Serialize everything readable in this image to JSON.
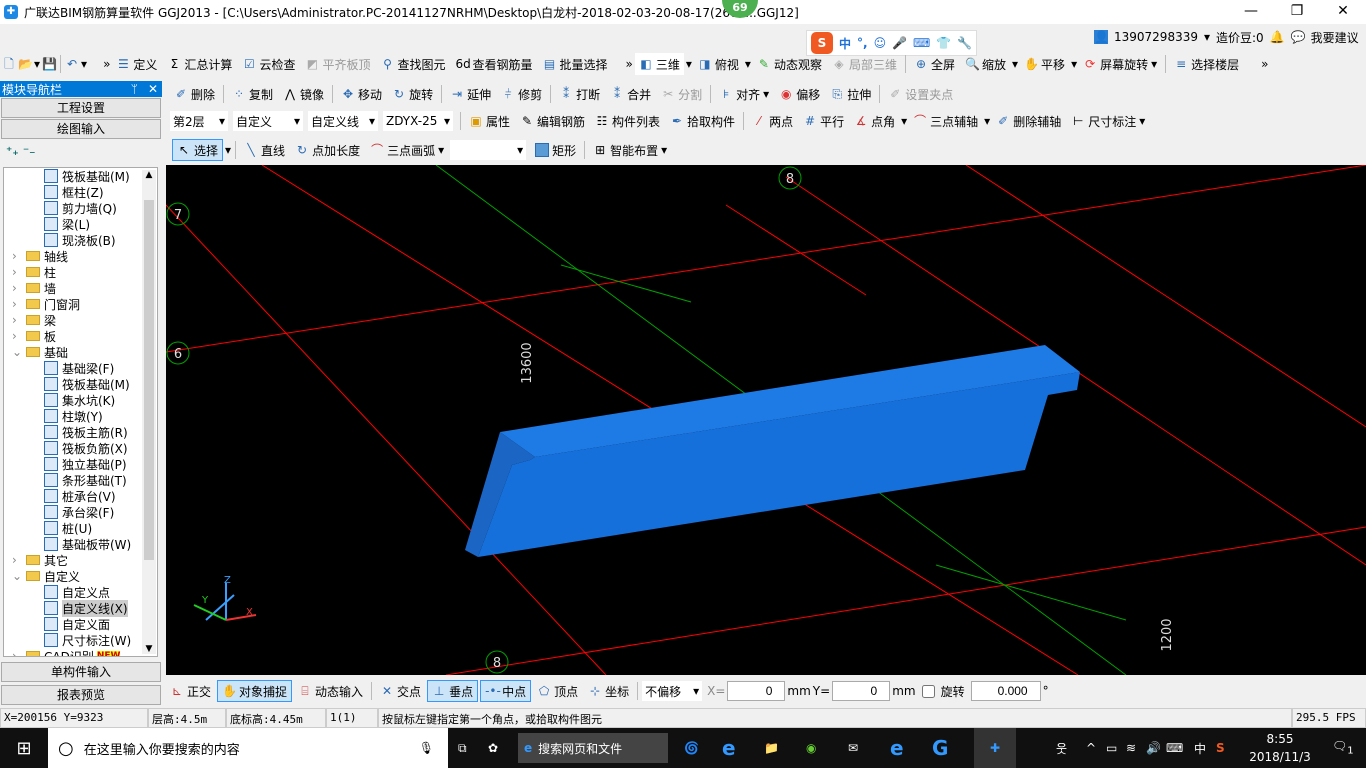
{
  "window": {
    "title": "广联达BIM钢筋算量软件 GGJ2013 - [C:\\Users\\Administrator.PC-20141127NRHM\\Desktop\\白龙村-2018-02-03-20-08-17(2605...GGJ12]",
    "badge": "69",
    "min": "—",
    "max": "❐",
    "close": "✕"
  },
  "user": {
    "phone": "13907298339",
    "beans": "造价豆:0",
    "suggest": "我要建议"
  },
  "ime": {
    "items": [
      "中",
      "°,",
      "☺",
      "🎤",
      "⌨",
      "👕",
      "🔧"
    ]
  },
  "toolbar1": {
    "left": [
      "定义",
      "汇总计算",
      "云检查",
      "平齐板顶",
      "查找图元",
      "查看钢筋量",
      "批量选择"
    ],
    "right": [
      "三维",
      "俯视",
      "动态观察",
      "局部三维",
      "全屏",
      "缩放",
      "平移",
      "屏幕旋转",
      "选择楼层"
    ]
  },
  "toolbar2": [
    "删除",
    "复制",
    "镜像",
    "移动",
    "旋转",
    "延伸",
    "修剪",
    "打断",
    "合并",
    "分割",
    "对齐",
    "偏移",
    "拉伸",
    "设置夹点"
  ],
  "toolbar3": {
    "floor": "第2层",
    "type": "自定义",
    "sub": "自定义线",
    "comp": "ZDYX-25",
    "buttons": [
      "属性",
      "编辑钢筋",
      "构件列表",
      "拾取构件",
      "两点",
      "平行",
      "点角",
      "三点辅轴",
      "删除辅轴",
      "尺寸标注"
    ]
  },
  "toolbar4": [
    "选择",
    "直线",
    "点加长度",
    "三点画弧",
    "矩形",
    "智能布置"
  ],
  "nav": {
    "title": "模块导航栏",
    "pin": "ᛘ",
    "close": "✕",
    "project_settings": "工程设置",
    "draw_input": "绘图输入",
    "single_input": "单构件输入",
    "report": "报表预览",
    "tree": [
      {
        "label": "筏板基础(M)",
        "level": 2
      },
      {
        "label": "框柱(Z)",
        "level": 2
      },
      {
        "label": "剪力墙(Q)",
        "level": 2
      },
      {
        "label": "梁(L)",
        "level": 2
      },
      {
        "label": "现浇板(B)",
        "level": 2
      },
      {
        "label": "轴线",
        "level": 1,
        "folder": true,
        "open": false
      },
      {
        "label": "柱",
        "level": 1,
        "folder": true,
        "open": false
      },
      {
        "label": "墙",
        "level": 1,
        "folder": true,
        "open": false
      },
      {
        "label": "门窗洞",
        "level": 1,
        "folder": true,
        "open": false
      },
      {
        "label": "梁",
        "level": 1,
        "folder": true,
        "open": false
      },
      {
        "label": "板",
        "level": 1,
        "folder": true,
        "open": false
      },
      {
        "label": "基础",
        "level": 1,
        "folder": true,
        "open": true
      },
      {
        "label": "基础梁(F)",
        "level": 2
      },
      {
        "label": "筏板基础(M)",
        "level": 2
      },
      {
        "label": "集水坑(K)",
        "level": 2
      },
      {
        "label": "柱墩(Y)",
        "level": 2
      },
      {
        "label": "筏板主筋(R)",
        "level": 2
      },
      {
        "label": "筏板负筋(X)",
        "level": 2
      },
      {
        "label": "独立基础(P)",
        "level": 2
      },
      {
        "label": "条形基础(T)",
        "level": 2
      },
      {
        "label": "桩承台(V)",
        "level": 2
      },
      {
        "label": "承台梁(F)",
        "level": 2
      },
      {
        "label": "桩(U)",
        "level": 2
      },
      {
        "label": "基础板带(W)",
        "level": 2
      },
      {
        "label": "其它",
        "level": 1,
        "folder": true,
        "open": false
      },
      {
        "label": "自定义",
        "level": 1,
        "folder": true,
        "open": true
      },
      {
        "label": "自定义点",
        "level": 2
      },
      {
        "label": "自定义线(X)",
        "level": 2,
        "selected": true
      },
      {
        "label": "自定义面",
        "level": 2
      },
      {
        "label": "尺寸标注(W)",
        "level": 2
      },
      {
        "label": "CAD识别",
        "level": 1,
        "folder": true,
        "open": false,
        "tag": "NEW"
      }
    ]
  },
  "viewport": {
    "axis_labels": [
      "7",
      "8",
      "6",
      "8"
    ],
    "dims": [
      "13600",
      "1200"
    ],
    "beam_color": "#1874e0",
    "axis_color": "#ff0000",
    "aux_color": "#00a000"
  },
  "snap": {
    "items": [
      "正交",
      "对象捕捉",
      "动态输入",
      "交点",
      "垂点",
      "中点",
      "顶点",
      "坐标"
    ],
    "offset": "不偏移",
    "x_label": "X=",
    "x": "0",
    "y_label": "Y=",
    "y": "0",
    "mm": "mm",
    "rotate": "旋转",
    "angle": "0.000",
    "deg": "°"
  },
  "status": {
    "coords": "X=200156 Y=9323",
    "floor_h": "层高:4.5m",
    "base_h": "底标高:4.45m",
    "count": "1(1)",
    "hint": "按鼠标左键指定第一个角点，或拾取构件图元",
    "fps": "295.5 FPS"
  },
  "taskbar": {
    "search": "在这里输入你要搜索的内容",
    "browser_search": "搜索网页和文件",
    "ime": "中",
    "time": "8:55",
    "date": "2018/11/3",
    "notif": "1"
  }
}
